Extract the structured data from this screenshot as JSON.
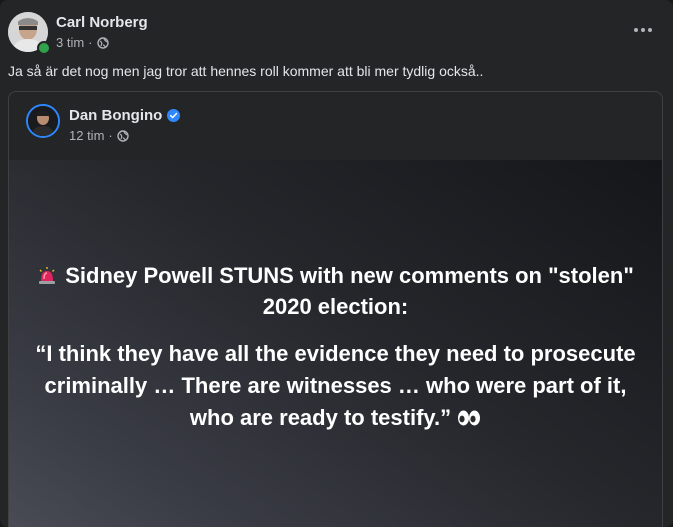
{
  "post": {
    "author": "Carl Norberg",
    "time": "3 tim",
    "separator": "·",
    "text": "Ja så är det nog men jag tror att hennes roll kommer att bli mer tydlig också.."
  },
  "shared": {
    "author": "Dan Bongino",
    "time": "12 tim",
    "separator": "·",
    "headline": "Sidney Powell STUNS with new comments on \"stolen\" 2020 election:",
    "quote": "“I think they have all the evidence they need to prosecute criminally … There are witnesses … who were part of it, who are ready to testify.”"
  },
  "icons": {
    "globe": "globe-icon",
    "more": "more-options-icon",
    "verified": "verified-badge-icon",
    "siren": "siren-icon",
    "eyes": "eyes-icon"
  },
  "colors": {
    "background": "#242526",
    "verified": "#2d88ff",
    "online": "#31a24c"
  }
}
